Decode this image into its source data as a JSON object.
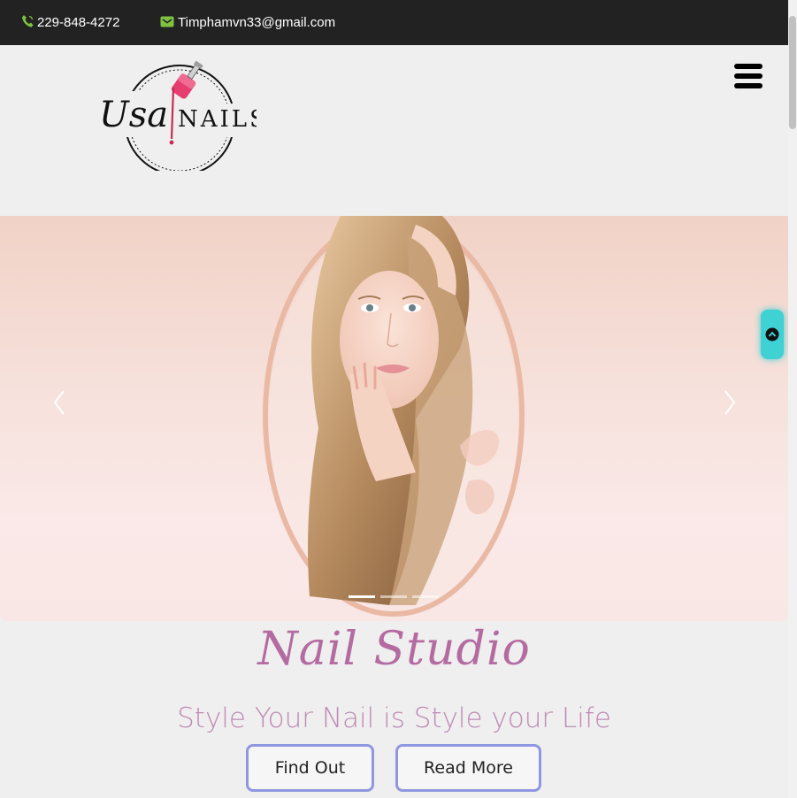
{
  "topbar": {
    "phone": "229-848-4272",
    "email": "Timphamvn33@gmail.com",
    "phone_icon": "phone-icon",
    "email_icon": "envelope-icon",
    "icon_color": "#7fc241"
  },
  "header": {
    "logo": {
      "script_text": "Usa",
      "caps_text": "NAILS"
    },
    "menu_icon": "hamburger-icon"
  },
  "slider": {
    "prev_icon": "chevron-left-icon",
    "next_icon": "chevron-right-icon",
    "slide_count": 3,
    "active_slide": 1
  },
  "scroll_top_icon": "chevron-up-circle-icon",
  "content": {
    "title": "Nail Studio",
    "tagline": "Style Your Nail is Style your Life",
    "buttons": {
      "find_out": "Find Out",
      "read_more": "Read More"
    }
  },
  "colors": {
    "topbar_bg": "#222222",
    "accent_teal": "#3fd1d3",
    "title_pink": "#b46ba1",
    "button_border": "#8f97e0"
  }
}
